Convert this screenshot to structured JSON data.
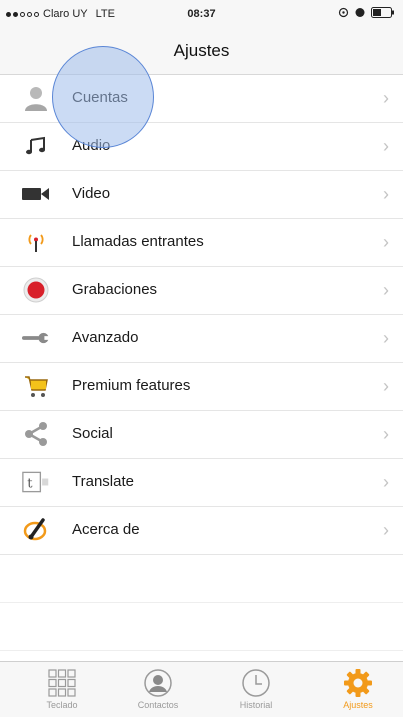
{
  "status_bar": {
    "carrier": "Claro UY",
    "network": "LTE",
    "time": "08:37"
  },
  "nav": {
    "title": "Ajustes"
  },
  "settings": [
    {
      "label": "Cuentas",
      "icon": "account-person-icon"
    },
    {
      "label": "Audio",
      "icon": "music-note-icon"
    },
    {
      "label": "Video",
      "icon": "video-camera-icon"
    },
    {
      "label": "Llamadas entrantes",
      "icon": "antenna-signal-icon"
    },
    {
      "label": "Grabaciones",
      "icon": "record-icon"
    },
    {
      "label": "Avanzado",
      "icon": "wrench-icon"
    },
    {
      "label": "Premium features",
      "icon": "shopping-cart-icon"
    },
    {
      "label": "Social",
      "icon": "share-icon"
    },
    {
      "label": "Translate",
      "icon": "translate-icon"
    },
    {
      "label": "Acerca de",
      "icon": "info-pen-icon"
    }
  ],
  "tabbar": {
    "tabs": [
      {
        "label": "Teclado",
        "icon": "keypad-icon"
      },
      {
        "label": "Contactos",
        "icon": "contacts-icon"
      },
      {
        "label": "Historial",
        "icon": "clock-icon"
      },
      {
        "label": "Ajustes",
        "icon": "gear-icon"
      }
    ],
    "active_index": 3
  },
  "colors": {
    "accent": "#f29a1a",
    "record_red": "#d8202a",
    "chevron": "#c4c4c4"
  }
}
